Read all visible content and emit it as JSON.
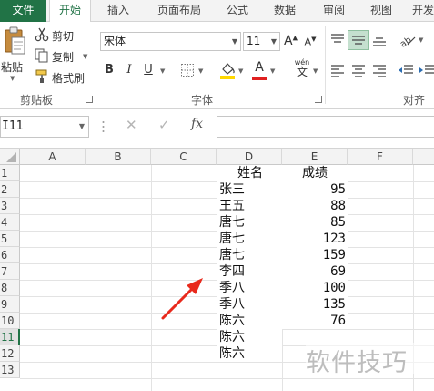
{
  "tabs": [
    {
      "label": "文件"
    },
    {
      "label": "开始"
    },
    {
      "label": "插入"
    },
    {
      "label": "页面布局"
    },
    {
      "label": "公式"
    },
    {
      "label": "数据"
    },
    {
      "label": "审阅"
    },
    {
      "label": "视图"
    },
    {
      "label": "开发"
    }
  ],
  "ribbon": {
    "clipboard": {
      "paste_label": "粘贴",
      "cut_label": "剪切",
      "copy_label": "复制",
      "format_painter_label": "格式刷",
      "group_label": "剪贴板"
    },
    "font": {
      "font_name": "宋体",
      "font_size": "11",
      "bold": "B",
      "italic": "I",
      "underline": "U",
      "grow": "A",
      "shrink": "A",
      "font_color_glyph": "A",
      "wen_glyph": "wén",
      "wen_sub": "文",
      "group_label": "字体"
    },
    "alignment": {
      "group_label": "对齐方"
    },
    "colors": {
      "fill_yellow": "#ffd800",
      "font_red": "#e02020",
      "accent_green": "#217346"
    }
  },
  "formula_bar": {
    "name_box": "I11",
    "cancel_glyph": "✕",
    "enter_glyph": "✓",
    "fx_label": "fx"
  },
  "sheet": {
    "columns": [
      "A",
      "B",
      "C",
      "D",
      "E",
      "F"
    ],
    "rows": [
      "1",
      "2",
      "3",
      "4",
      "5",
      "6",
      "7",
      "8",
      "9",
      "10",
      "11",
      "12",
      "13"
    ],
    "selected_row": "11",
    "cells": {
      "D1": "姓名",
      "E1": "成绩",
      "D2": "张三",
      "E2": "95",
      "D3": "王五",
      "E3": "88",
      "D4": "唐七",
      "E4": "85",
      "D5": "唐七",
      "E5": "123",
      "D6": "唐七",
      "E6": "159",
      "D7": "李四",
      "E7": "69",
      "D8": "季八",
      "E8": "100",
      "D9": "季八",
      "E9": "135",
      "D10": "陈六",
      "E10": "76",
      "D11": "陈六",
      "D12": "陈六"
    }
  },
  "annotation": {
    "arrow_color": "#e8291c"
  },
  "watermark": "软件技巧"
}
